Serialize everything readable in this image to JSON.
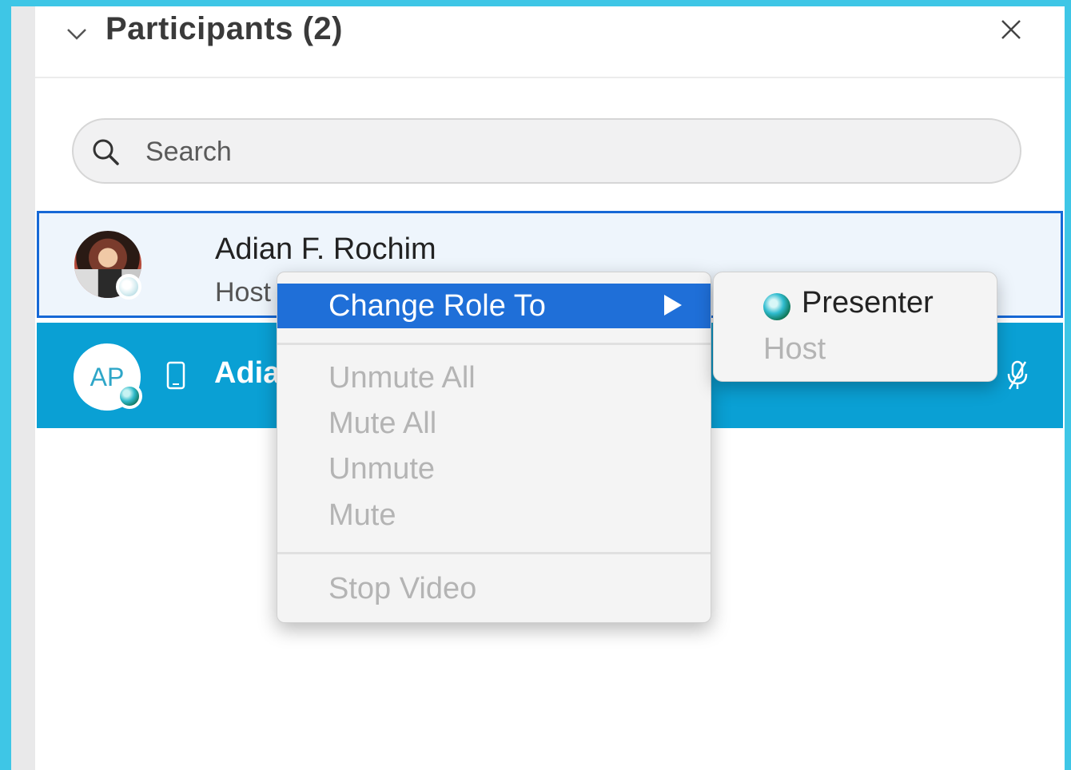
{
  "panel": {
    "title": "Participants (2)",
    "search": {
      "placeholder": "Search"
    }
  },
  "participants": [
    {
      "name": "Adian F. Rochim",
      "role": "Host"
    },
    {
      "name": "Adia",
      "initials": "AP"
    }
  ],
  "context_menu": {
    "items": [
      {
        "label": "Change Role To",
        "enabled": true,
        "has_submenu": true
      },
      {
        "label": "Unmute All",
        "enabled": false
      },
      {
        "label": "Mute All",
        "enabled": false
      },
      {
        "label": "Unmute",
        "enabled": false
      },
      {
        "label": "Mute",
        "enabled": false
      },
      {
        "label": "Stop Video",
        "enabled": false
      }
    ]
  },
  "role_submenu": {
    "items": [
      {
        "label": "Presenter",
        "enabled": true,
        "icon": "presenter-ball-icon"
      },
      {
        "label": "Host",
        "enabled": false
      }
    ]
  },
  "colors": {
    "background": "#3ec6e6",
    "selected_row": "#0aa0d4",
    "focused_row_border": "#1668d6",
    "menu_highlight": "#1f6fd8"
  }
}
